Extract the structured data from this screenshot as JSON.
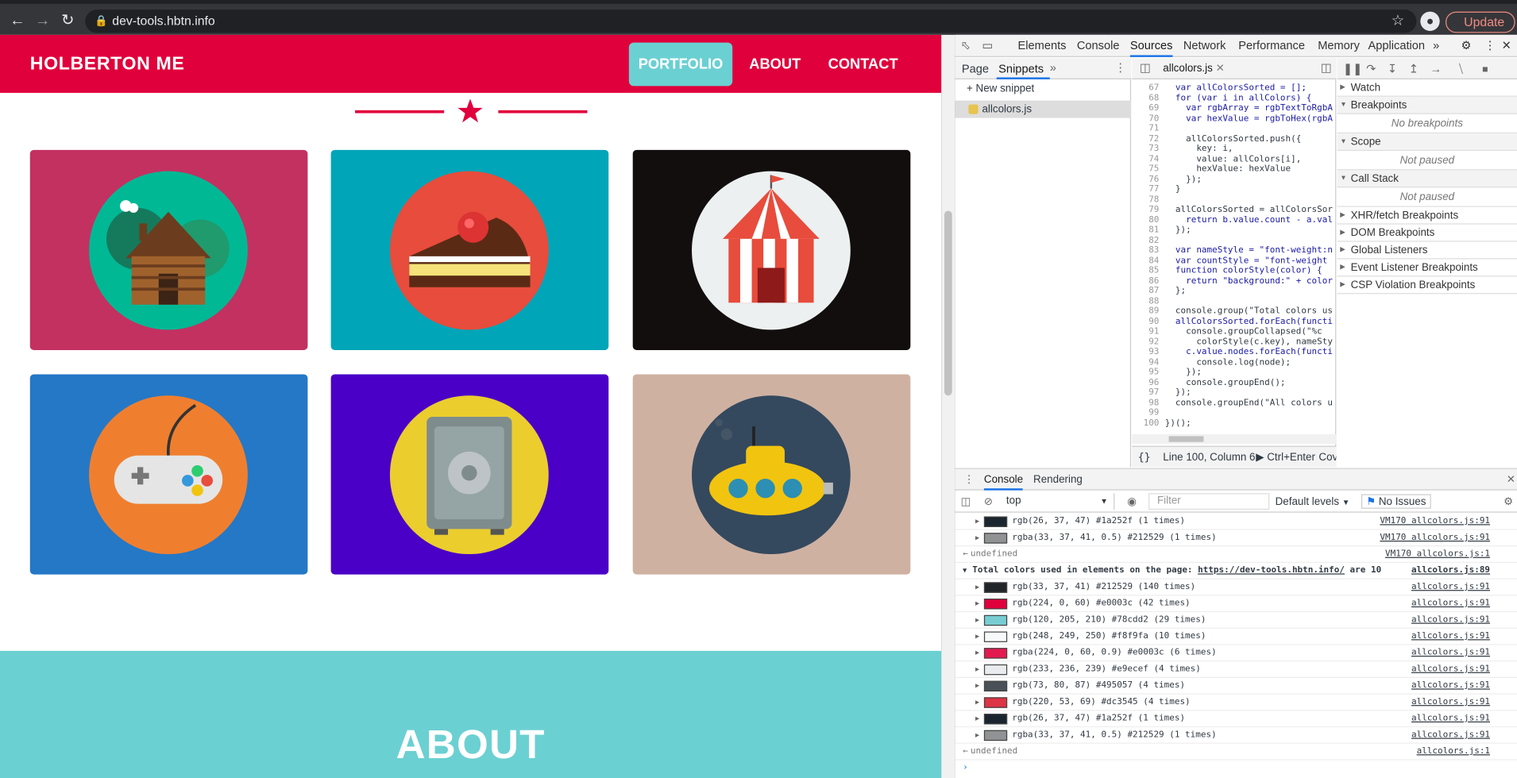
{
  "browser": {
    "url": "dev-tools.hbtn.info",
    "update_label": "Update"
  },
  "site": {
    "brand": "HOLBERTON ME",
    "nav": [
      {
        "label": "PORTFOLIO",
        "active": true
      },
      {
        "label": "ABOUT",
        "active": false
      },
      {
        "label": "CONTACT",
        "active": false
      }
    ],
    "portfolio": [
      {
        "name": "cabin",
        "bg": "#c33161",
        "circle": "#00b894"
      },
      {
        "name": "cake",
        "bg": "#00a5b8",
        "circle": "#e74c3c"
      },
      {
        "name": "circus",
        "bg": "#130e0e",
        "circle": "#ecf0f1"
      },
      {
        "name": "game-controller",
        "bg": "#2478c6",
        "circle": "#ef7f2f"
      },
      {
        "name": "safe",
        "bg": "#4a00c6",
        "circle": "#ebcd2e"
      },
      {
        "name": "submarine",
        "bg": "#cfb1a2",
        "circle": "#34495e"
      }
    ],
    "about_title": "ABOUT",
    "colors": {
      "primary": "#e0003c",
      "accent": "#78cdd2"
    }
  },
  "devtools": {
    "tabs": [
      "Elements",
      "Console",
      "Sources",
      "Network",
      "Performance",
      "Memory",
      "Application"
    ],
    "active_tab": "Sources",
    "left_tabs": [
      "Page",
      "Snippets"
    ],
    "new_snippet": "New snippet",
    "snippet_file": "allcolors.js",
    "open_file": "allcolors.js",
    "code_lines": [
      {
        "n": "67",
        "t": "  var allColorsSorted = [];"
      },
      {
        "n": "68",
        "t": "  for (var i in allColors) {"
      },
      {
        "n": "69",
        "t": "    var rgbArray = rgbTextToRgbA"
      },
      {
        "n": "70",
        "t": "    var hexValue = rgbToHex(rgbA"
      },
      {
        "n": "71",
        "t": ""
      },
      {
        "n": "72",
        "t": "    allColorsSorted.push({"
      },
      {
        "n": "73",
        "t": "      key: i,"
      },
      {
        "n": "74",
        "t": "      value: allColors[i],"
      },
      {
        "n": "75",
        "t": "      hexValue: hexValue"
      },
      {
        "n": "76",
        "t": "    });"
      },
      {
        "n": "77",
        "t": "  }"
      },
      {
        "n": "78",
        "t": ""
      },
      {
        "n": "79",
        "t": "  allColorsSorted = allColorsSor"
      },
      {
        "n": "80",
        "t": "    return b.value.count - a.val"
      },
      {
        "n": "81",
        "t": "  });"
      },
      {
        "n": "82",
        "t": ""
      },
      {
        "n": "83",
        "t": "  var nameStyle = \"font-weight:n"
      },
      {
        "n": "84",
        "t": "  var countStyle = \"font-weight"
      },
      {
        "n": "85",
        "t": "  function colorStyle(color) {"
      },
      {
        "n": "86",
        "t": "    return \"background:\" + color"
      },
      {
        "n": "87",
        "t": "  };"
      },
      {
        "n": "88",
        "t": ""
      },
      {
        "n": "89",
        "t": "  console.group(\"Total colors us"
      },
      {
        "n": "90",
        "t": "  allColorsSorted.forEach(functi"
      },
      {
        "n": "91",
        "t": "    console.groupCollapsed(\"%c"
      },
      {
        "n": "92",
        "t": "      colorStyle(c.key), nameSty"
      },
      {
        "n": "93",
        "t": "    c.value.nodes.forEach(functi"
      },
      {
        "n": "94",
        "t": "      console.log(node);"
      },
      {
        "n": "95",
        "t": "    });"
      },
      {
        "n": "96",
        "t": "    console.groupEnd();"
      },
      {
        "n": "97",
        "t": "  });"
      },
      {
        "n": "98",
        "t": "  console.groupEnd(\"All colors u"
      },
      {
        "n": "99",
        "t": ""
      },
      {
        "n": "100",
        "t": "})();"
      }
    ],
    "status": "Line 100, Column 6",
    "run_hint": "Ctrl+Enter",
    "coverage": "Cove",
    "debugger": {
      "watch": "Watch",
      "breakpoints": "Breakpoints",
      "no_breakpoints": "No breakpoints",
      "scope": "Scope",
      "not_paused": "Not paused",
      "call_stack": "Call Stack",
      "more": [
        "XHR/fetch Breakpoints",
        "DOM Breakpoints",
        "Global Listeners",
        "Event Listener Breakpoints",
        "CSP Violation Breakpoints"
      ]
    },
    "drawer_tabs": [
      "Console",
      "Rendering"
    ],
    "context": "top",
    "filter_placeholder": "Filter",
    "levels": "Default levels",
    "issues": "No Issues",
    "console_rows_top": [
      {
        "swatch": "#1a252f",
        "text": "rgb(26, 37, 47) #1a252f (1 times)",
        "src": "VM170 allcolors.js:91"
      },
      {
        "swatch": "#909294",
        "text": "rgba(33, 37, 41, 0.5) #212529 (1 times)",
        "src": "VM170 allcolors.js:91"
      }
    ],
    "undefined_1": "undefined",
    "undefined_1_src": "VM170 allcolors.js:1",
    "group_label_prefix": "Total colors used in elements on the page:",
    "group_link": "https://dev-tools.hbtn.info/",
    "group_label_suffix": "are 10",
    "group_src": "allcolors.js:89",
    "console_rows": [
      {
        "swatch": "#212529",
        "text": "rgb(33, 37, 41) #212529 (140 times)",
        "src": "allcolors.js:91"
      },
      {
        "swatch": "#e0003c",
        "text": "rgb(224, 0, 60) #e0003c (42 times)",
        "src": "allcolors.js:91"
      },
      {
        "swatch": "#78cdd2",
        "text": "rgb(120, 205, 210) #78cdd2 (29 times)",
        "src": "allcolors.js:91"
      },
      {
        "swatch": "#f8f9fa",
        "text": "rgb(248, 249, 250) #f8f9fa (10 times)",
        "src": "allcolors.js:91"
      },
      {
        "swatch": "#e31a50",
        "text": "rgba(224, 0, 60, 0.9) #e0003c (6 times)",
        "src": "allcolors.js:91"
      },
      {
        "swatch": "#e9ecef",
        "text": "rgb(233, 236, 239) #e9ecef (4 times)",
        "src": "allcolors.js:91"
      },
      {
        "swatch": "#495057",
        "text": "rgb(73, 80, 87) #495057 (4 times)",
        "src": "allcolors.js:91"
      },
      {
        "swatch": "#dc3545",
        "text": "rgb(220, 53, 69) #dc3545 (4 times)",
        "src": "allcolors.js:91"
      },
      {
        "swatch": "#1a252f",
        "text": "rgb(26, 37, 47) #1a252f (1 times)",
        "src": "allcolors.js:91"
      },
      {
        "swatch": "#909294",
        "text": "rgba(33, 37, 41, 0.5) #212529 (1 times)",
        "src": "allcolors.js:91"
      }
    ],
    "undefined_2": "undefined",
    "undefined_2_src": "allcolors.js:1"
  }
}
